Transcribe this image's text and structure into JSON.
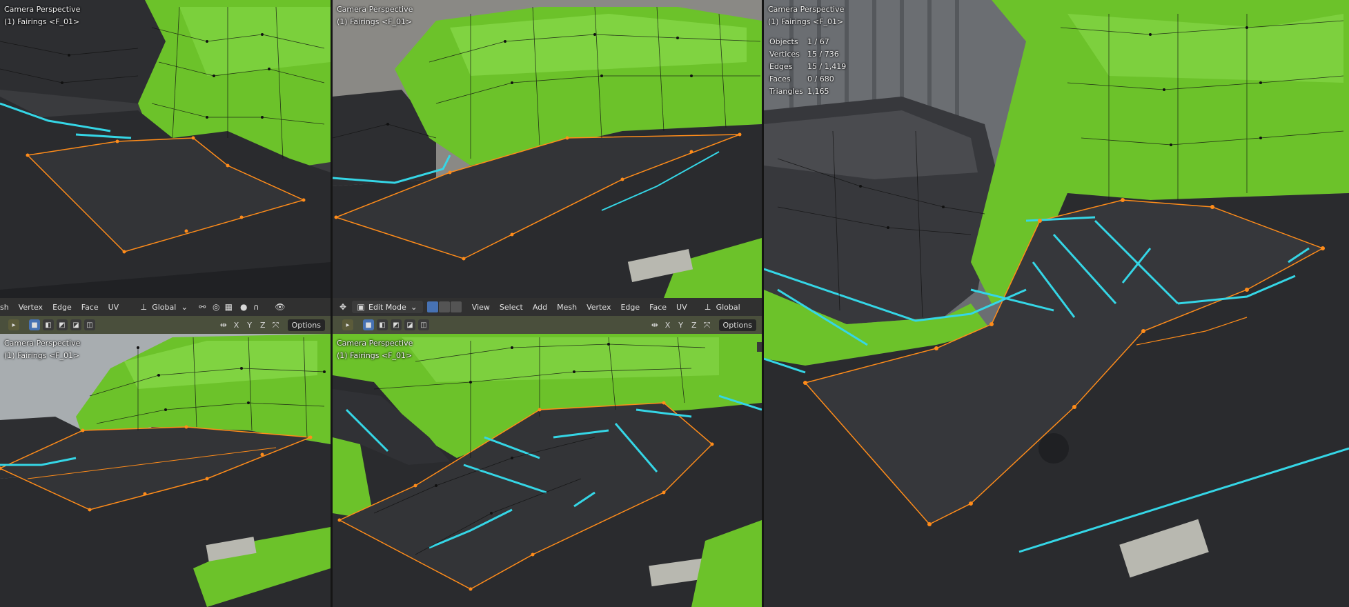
{
  "viewports": {
    "top_left": {
      "overlay_line1": "Camera Perspective",
      "overlay_line2": "(1) Fairings <F_01>"
    },
    "top_middle": {
      "overlay_line1": "Camera Perspective",
      "overlay_line2": "(1) Fairings <F_01>"
    },
    "right": {
      "overlay_line1": "Camera Perspective",
      "overlay_line2": "(1) Fairings <F_01>",
      "stats": [
        {
          "label": "Objects",
          "value": "1 / 67"
        },
        {
          "label": "Vertices",
          "value": "15 / 736"
        },
        {
          "label": "Edges",
          "value": "15 / 1,419"
        },
        {
          "label": "Faces",
          "value": "0 / 680"
        },
        {
          "label": "Triangles",
          "value": "1,165"
        }
      ]
    },
    "bottom_left": {
      "overlay_line1": "Camera Perspective",
      "overlay_line2": "(1) Fairings <F_01>"
    },
    "bottom_middle": {
      "overlay_line1": "Camera Perspective",
      "overlay_line2": "(1) Fairings <F_01>"
    }
  },
  "header_left": {
    "menu": [
      "sh",
      "Vertex",
      "Edge",
      "Face",
      "UV"
    ],
    "orientation": "Global"
  },
  "header_mid": {
    "mode": "Edit Mode",
    "menu": [
      "View",
      "Select",
      "Add",
      "Mesh",
      "Vertex",
      "Edge",
      "Face",
      "UV"
    ],
    "orientation": "Global"
  },
  "toolbar_left": {
    "axes": [
      "X",
      "Y",
      "Z"
    ],
    "options": "Options"
  },
  "toolbar_mid": {
    "axes": [
      "X",
      "Y",
      "Z"
    ],
    "options": "Options"
  },
  "colors": {
    "green_body": "#6cc22a",
    "seat": "#2b2c2e",
    "edge_select": "#ff8c1a",
    "seam": "#35d6e6",
    "header": "#303030",
    "toolbar": "#4a4f3c"
  }
}
